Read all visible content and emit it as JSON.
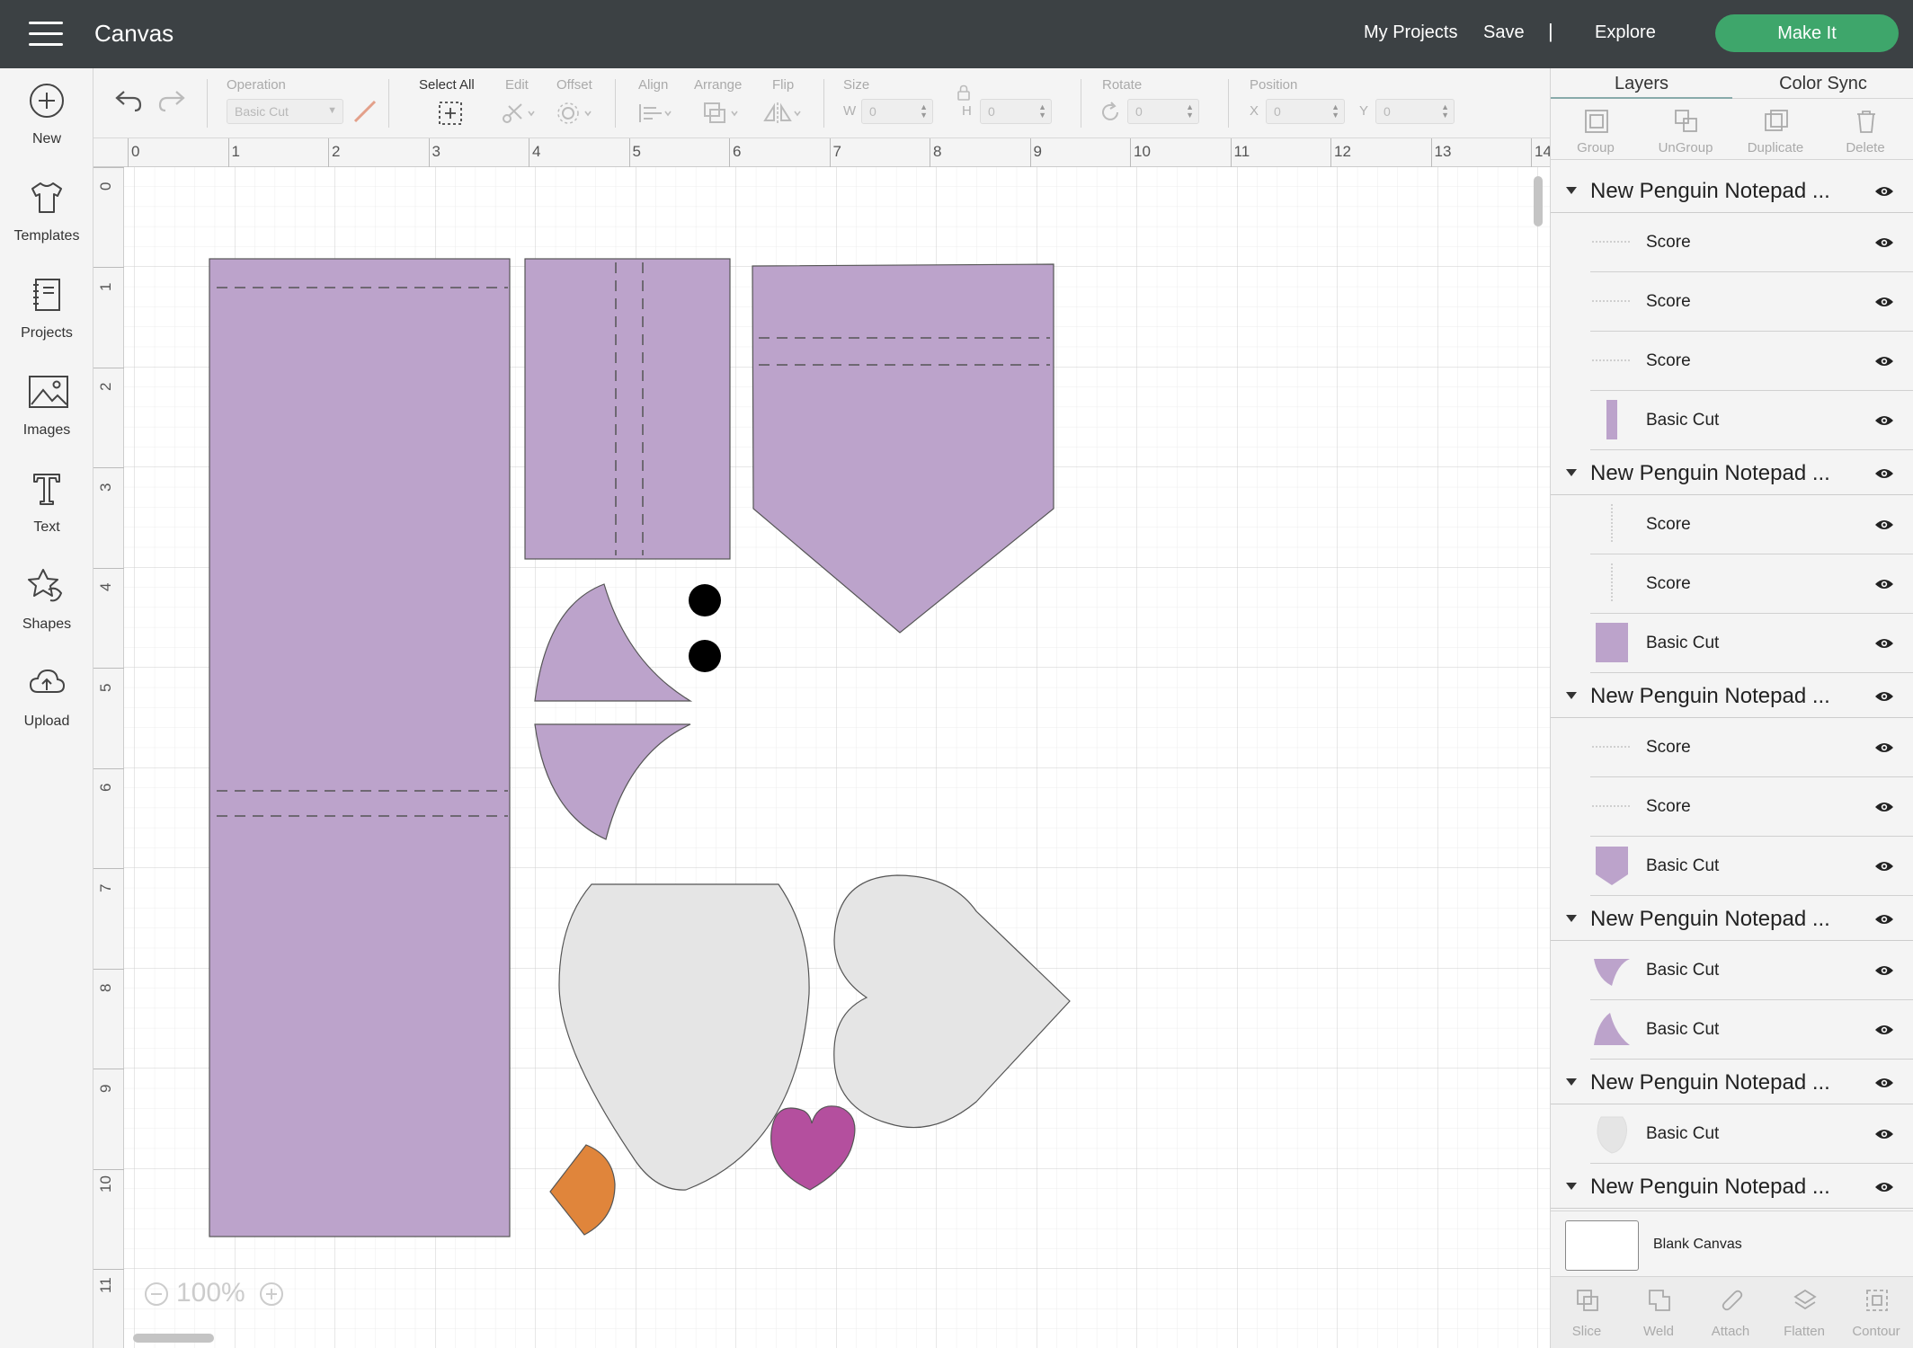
{
  "header": {
    "title": "Canvas",
    "links": [
      "My Projects",
      "Save",
      "Explore"
    ],
    "separator": "|",
    "make_it": "Make It"
  },
  "sidebar": {
    "items": [
      {
        "label": "New",
        "icon": "plus-circle-icon"
      },
      {
        "label": "Templates",
        "icon": "tshirt-icon"
      },
      {
        "label": "Projects",
        "icon": "notebook-icon"
      },
      {
        "label": "Images",
        "icon": "image-icon"
      },
      {
        "label": "Text",
        "icon": "text-t-icon"
      },
      {
        "label": "Shapes",
        "icon": "shapes-icon"
      },
      {
        "label": "Upload",
        "icon": "cloud-upload-icon"
      }
    ]
  },
  "toolbar": {
    "operation_label": "Operation",
    "operation_value": "Basic Cut",
    "select_all": "Select All",
    "edit": "Edit",
    "offset": "Offset",
    "align": "Align",
    "arrange": "Arrange",
    "flip": "Flip",
    "size": "Size",
    "w_label": "W",
    "w_value": "0",
    "h_label": "H",
    "h_value": "0",
    "rotate": "Rotate",
    "rotate_value": "0",
    "position": "Position",
    "x_label": "X",
    "x_value": "0",
    "y_label": "Y",
    "y_value": "0"
  },
  "canvas": {
    "ruler_top": [
      "0",
      "1",
      "2",
      "3",
      "4",
      "5",
      "6",
      "7",
      "8",
      "9",
      "10",
      "11",
      "12",
      "13",
      "14"
    ],
    "ruler_left": [
      "0",
      "1",
      "2",
      "3",
      "4",
      "5",
      "6",
      "7",
      "8",
      "9",
      "10",
      "11"
    ],
    "zoom": "100%",
    "colors": {
      "purple": "#bca3cb",
      "gray": "#e5e5e5",
      "magenta": "#b44f9e",
      "orange": "#e0853b",
      "black": "#000000",
      "grid": "#e8e8e8"
    }
  },
  "panel": {
    "tabs": [
      "Layers",
      "Color Sync"
    ],
    "tools": [
      "Group",
      "UnGroup",
      "Duplicate",
      "Delete"
    ],
    "groups": [
      {
        "name": "New Penguin Notepad ...",
        "layers": [
          {
            "name": "Score",
            "thumb": "score"
          },
          {
            "name": "Score",
            "thumb": "score"
          },
          {
            "name": "Score",
            "thumb": "score"
          },
          {
            "name": "Basic Cut",
            "thumb": "thin-rect"
          }
        ]
      },
      {
        "name": "New Penguin Notepad ...",
        "layers": [
          {
            "name": "Score",
            "thumb": "score-v"
          },
          {
            "name": "Score",
            "thumb": "score-v"
          },
          {
            "name": "Basic Cut",
            "thumb": "rect"
          }
        ]
      },
      {
        "name": "New Penguin Notepad ...",
        "layers": [
          {
            "name": "Score",
            "thumb": "score"
          },
          {
            "name": "Score",
            "thumb": "score"
          },
          {
            "name": "Basic Cut",
            "thumb": "pocket"
          }
        ]
      },
      {
        "name": "New Penguin Notepad ...",
        "layers": [
          {
            "name": "Basic Cut",
            "thumb": "wing-down"
          },
          {
            "name": "Basic Cut",
            "thumb": "wing-up"
          }
        ]
      },
      {
        "name": "New Penguin Notepad ...",
        "layers": [
          {
            "name": "Basic Cut",
            "thumb": "egg"
          }
        ]
      },
      {
        "name": "New Penguin Notepad ...",
        "layers": []
      }
    ],
    "blank_canvas": "Blank Canvas",
    "bottom_tools": [
      "Slice",
      "Weld",
      "Attach",
      "Flatten",
      "Contour"
    ]
  }
}
